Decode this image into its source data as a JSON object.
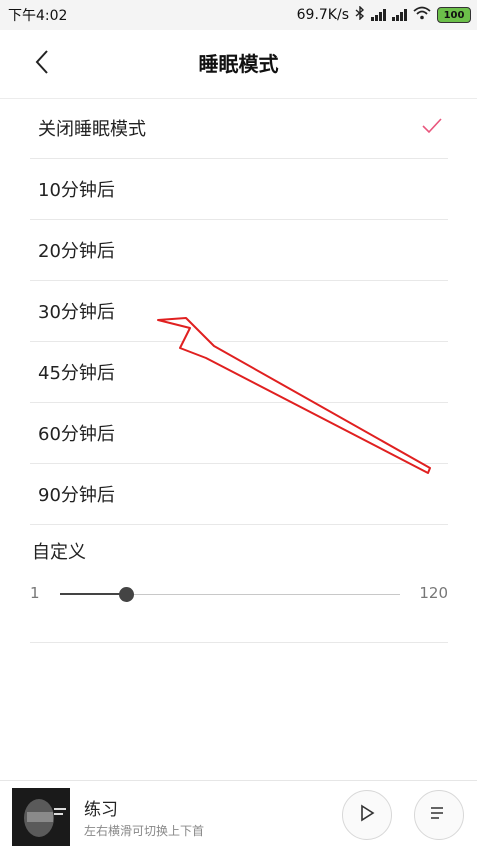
{
  "status_bar": {
    "time": "下午4:02",
    "network_speed": "69.7K/s",
    "battery": "100"
  },
  "header": {
    "title": "睡眠模式",
    "back_icon": "chevron-left-icon"
  },
  "options": [
    {
      "label": "关闭睡眠模式",
      "selected": true
    },
    {
      "label": "10分钟后",
      "selected": false
    },
    {
      "label": "20分钟后",
      "selected": false
    },
    {
      "label": "30分钟后",
      "selected": false
    },
    {
      "label": "45分钟后",
      "selected": false
    },
    {
      "label": "60分钟后",
      "selected": false
    },
    {
      "label": "90分钟后",
      "selected": false
    }
  ],
  "custom": {
    "title": "自定义",
    "min": "1",
    "max": "120",
    "value": 24
  },
  "player": {
    "title": "练习",
    "hint": "左右横滑可切换上下首"
  },
  "colors": {
    "check": "#e9567d",
    "annotation_arrow": "#e02020",
    "slider": "#444444",
    "battery": "#6cc04a"
  }
}
